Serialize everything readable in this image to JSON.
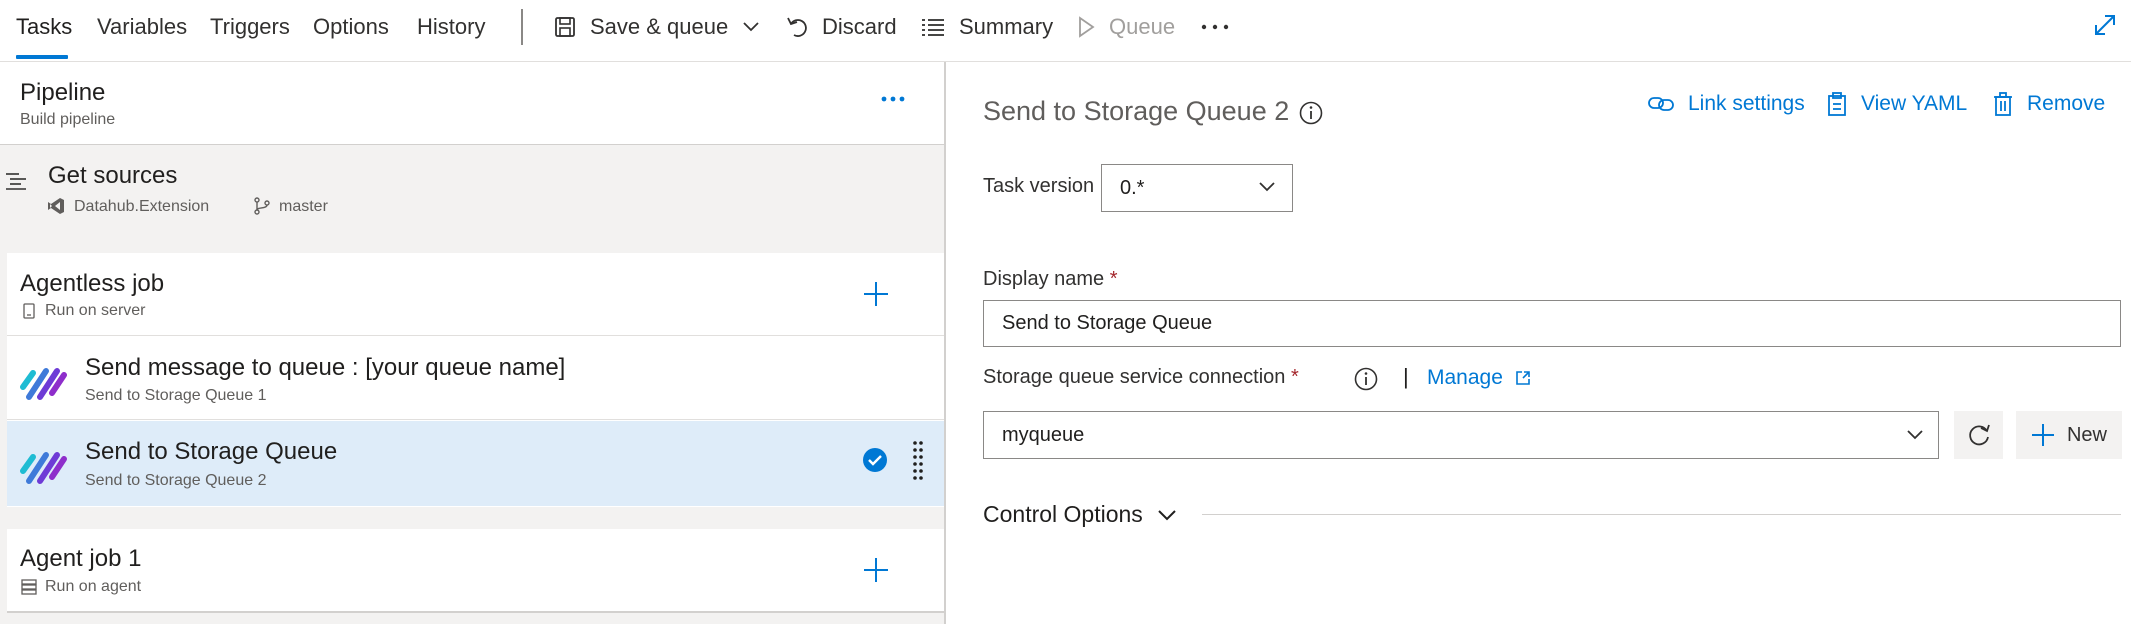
{
  "toolbar": {
    "tabs": [
      {
        "label": "Tasks",
        "active": true
      },
      {
        "label": "Variables"
      },
      {
        "label": "Triggers"
      },
      {
        "label": "Options"
      },
      {
        "label": "History"
      }
    ],
    "actions": {
      "save_queue": "Save & queue",
      "discard": "Discard",
      "summary": "Summary",
      "queue": "Queue"
    },
    "icons": [
      "save-icon",
      "chevron-down-icon",
      "undo-icon",
      "list-icon",
      "play-icon",
      "more-icon",
      "expand-icon"
    ]
  },
  "pipeline": {
    "title": "Pipeline",
    "subtitle": "Build pipeline"
  },
  "get_sources": {
    "title": "Get sources",
    "repo": "Datahub.Extension",
    "branch": "master"
  },
  "agentless_job": {
    "title": "Agentless job",
    "subtitle": "Run on server"
  },
  "tasks": [
    {
      "title": "Send message to queue : [your queue name]",
      "subtitle": "Send to Storage Queue 1",
      "selected": false
    },
    {
      "title": "Send to Storage Queue",
      "subtitle": "Send to Storage Queue 2",
      "selected": true
    }
  ],
  "agent_job": {
    "title": "Agent job 1",
    "subtitle": "Run on agent"
  },
  "detail": {
    "title": "Send to Storage Queue 2",
    "links": {
      "link_settings": "Link settings",
      "view_yaml": "View YAML",
      "remove": "Remove"
    },
    "task_version_label": "Task version",
    "task_version_value": "0.*",
    "display_name_label": "Display name",
    "display_name_value": "Send to Storage Queue",
    "required_mark": "*",
    "connection_label": "Storage queue service connection",
    "manage_label": "Manage",
    "separator": "|",
    "connection_value": "myqueue",
    "new_label": "New",
    "control_options_label": "Control Options"
  },
  "colors": {
    "accent": "#0078d4",
    "selected_row": "#deecf9",
    "required": "#a4262c",
    "panel_bg": "#f3f2f1"
  }
}
